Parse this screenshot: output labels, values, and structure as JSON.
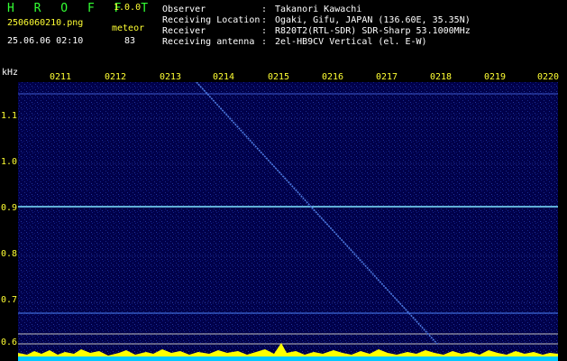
{
  "app": {
    "name": "H R O F F T",
    "version": "1.0.0"
  },
  "file": {
    "name": "2506060210.png",
    "type": "meteor",
    "datetime": "25.06.06 02:10",
    "count": "83"
  },
  "info": [
    {
      "key": "Observer",
      "value": "Takanori Kawachi"
    },
    {
      "key": "Receiving Location",
      "value": "Ogaki, Gifu, JAPAN (136.60E, 35.35N)"
    },
    {
      "key": "Receiver",
      "value": "R820T2(RTL-SDR) SDR-Sharp 53.1000MHz"
    },
    {
      "key": "Receiving antenna",
      "value": "2el-HB9CV Vertical (el. E-W)"
    }
  ],
  "axis": {
    "unit": "kHz",
    "y_ticks": [
      "1.1",
      "1.0",
      "0.9",
      "0.8",
      "0.7",
      "0.6"
    ],
    "x_ticks": [
      "0211",
      "0212",
      "0213",
      "0214",
      "0215",
      "0216",
      "0217",
      "0218",
      "0219",
      "0220"
    ]
  },
  "colors": {
    "title": "#33ff33",
    "label": "#ffff33",
    "text": "#ffffff",
    "bg": "#00004a",
    "bar": "#ffff00",
    "baseline": "#00c8ff"
  }
}
